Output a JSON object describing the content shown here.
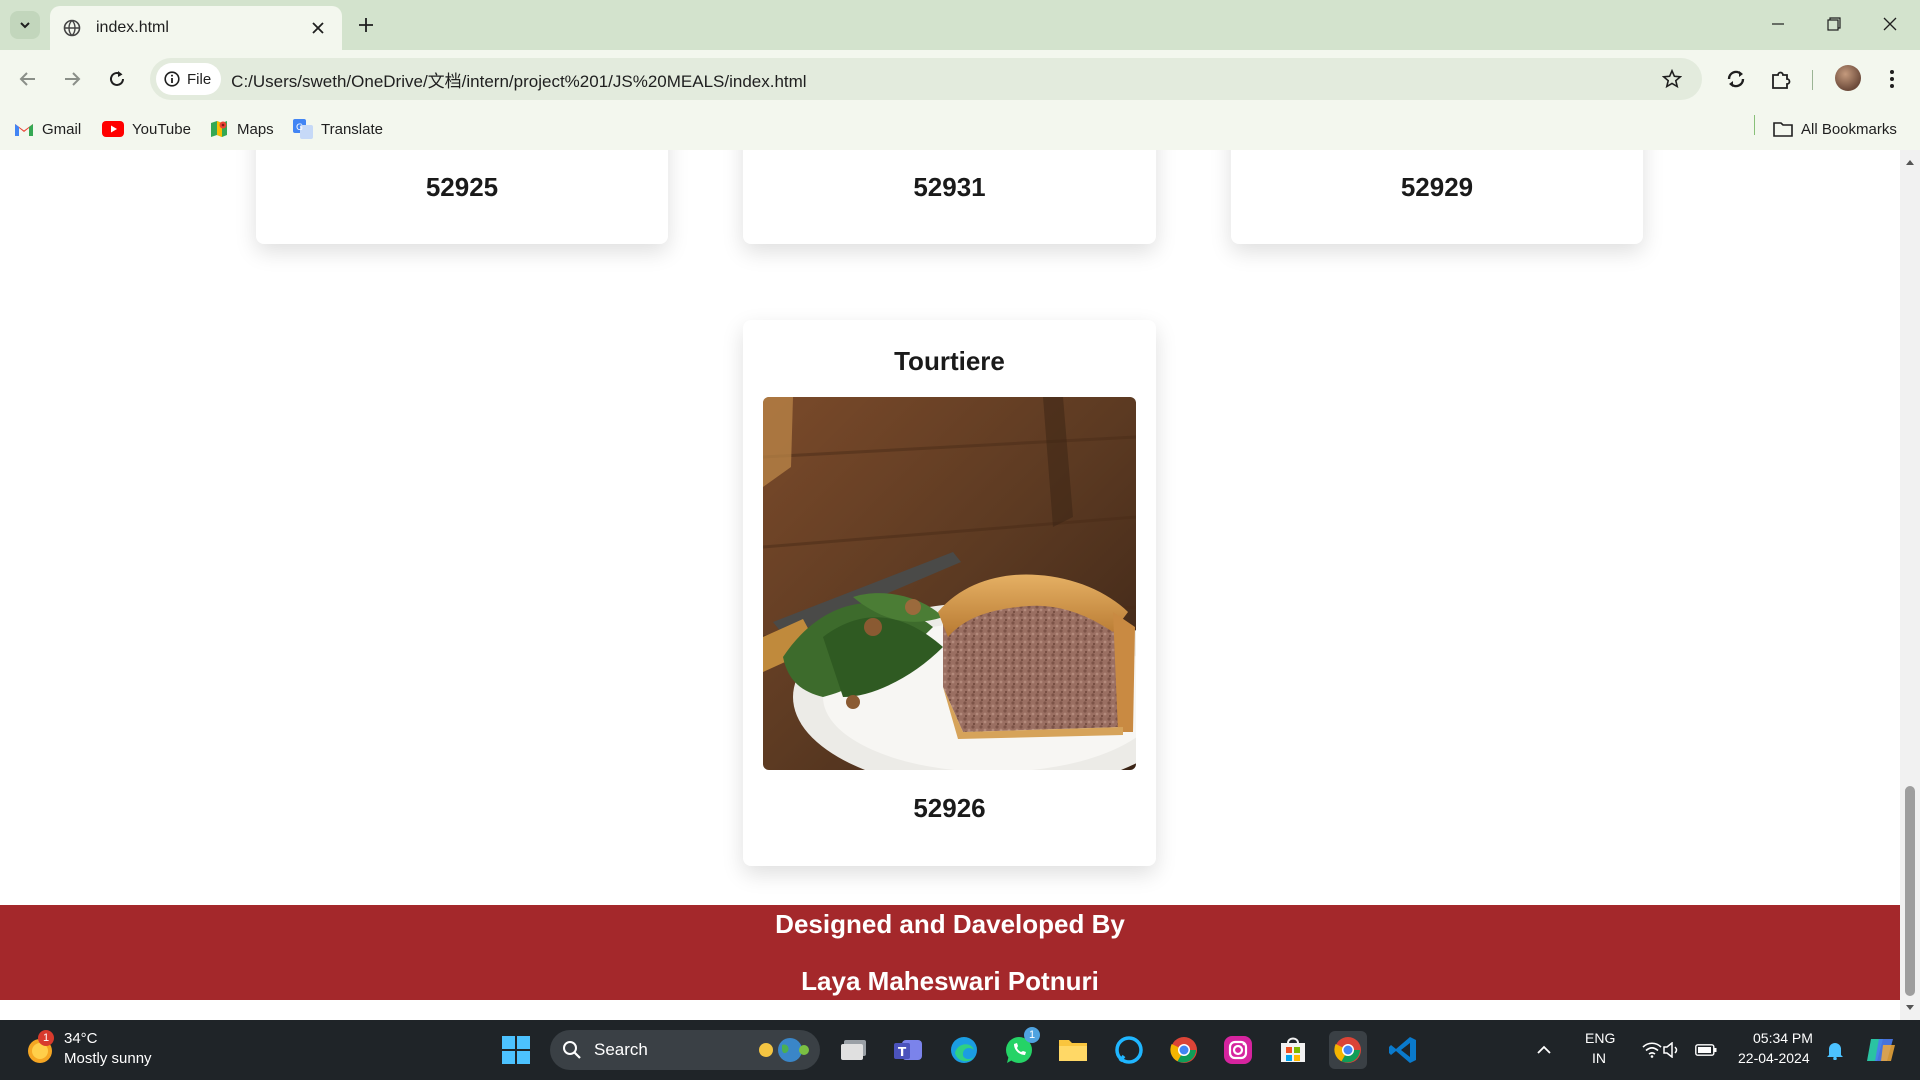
{
  "browser": {
    "tab_title": "index.html",
    "file_chip_label": "File",
    "url": "C:/Users/sweth/OneDrive/文档/intern/project%201/JS%20MEALS/index.html",
    "bookmarks": [
      {
        "label": "Gmail"
      },
      {
        "label": "YouTube"
      },
      {
        "label": "Maps"
      },
      {
        "label": "Translate"
      }
    ],
    "all_bookmarks_label": "All Bookmarks"
  },
  "page": {
    "top_cards": [
      {
        "id": "52925"
      },
      {
        "id": "52931"
      },
      {
        "id": "52929"
      }
    ],
    "featured_card": {
      "title": "Tourtiere",
      "id": "52926"
    },
    "footer": {
      "line1": "Designed and Daveloped By",
      "line2": "Laya Maheswari Potnuri"
    },
    "colors": {
      "footer_bg": "#a4282b",
      "tabstrip_bg": "#d3e3cd"
    }
  },
  "taskbar": {
    "weather": {
      "temp": "34°C",
      "condition": "Mostly sunny",
      "badge": "1"
    },
    "search_placeholder": "Search",
    "whatsapp_badge": "1",
    "lang_line1": "ENG",
    "lang_line2": "IN",
    "time": "05:34 PM",
    "date": "22-04-2024"
  }
}
